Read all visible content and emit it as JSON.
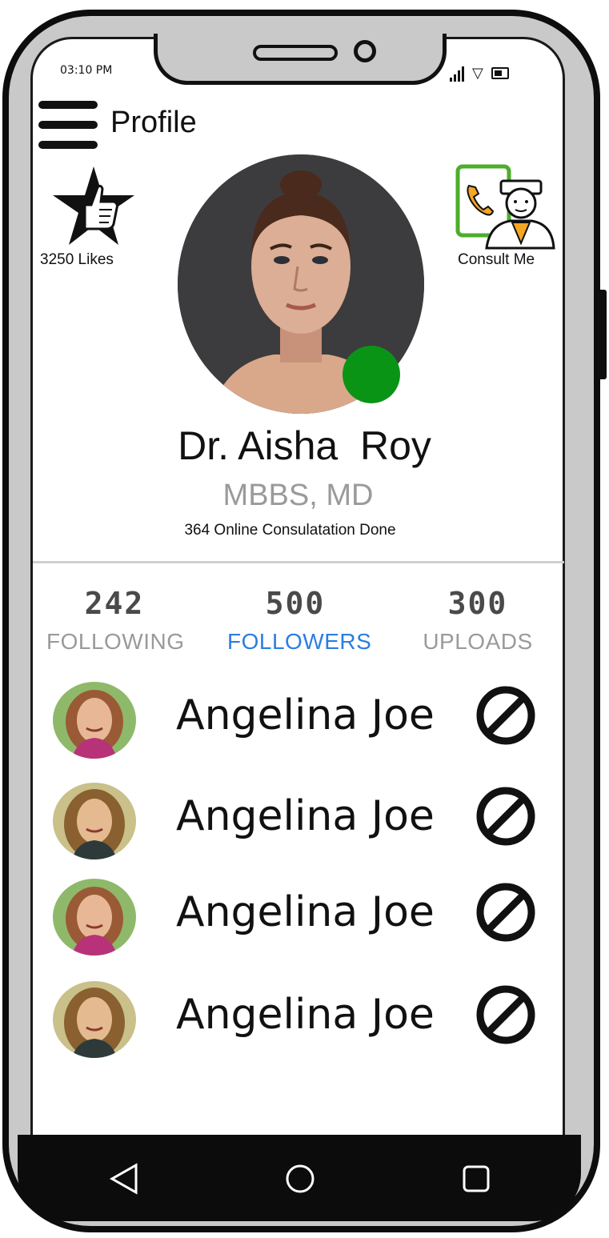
{
  "status_bar": {
    "time": "03:10 PM"
  },
  "header": {
    "title": "Profile"
  },
  "likes": {
    "label": "3250 Likes"
  },
  "consult": {
    "label": "Consult Me"
  },
  "profile": {
    "name": "Dr. Aisha  Roy",
    "degree": "MBBS, MD",
    "consultations": "364 Online Consulatation Done",
    "online_color": "#0a9416"
  },
  "stats": [
    {
      "value": "242",
      "label": "FOLLOWING"
    },
    {
      "value": "500",
      "label": "FOLLOWERS",
      "active": true
    },
    {
      "value": "300",
      "label": "UPLOADS"
    }
  ],
  "active_color": "#2b7de1",
  "followers": [
    {
      "name": "Angelina Joe",
      "action_icon": "block-icon"
    },
    {
      "name": "Angelina Joe",
      "action_icon": "block-icon"
    },
    {
      "name": "Angelina Joe",
      "action_icon": "block-icon"
    },
    {
      "name": "Angelina Joe",
      "action_icon": "block-icon"
    }
  ],
  "nav": {
    "back": "back-triangle-icon",
    "home": "home-circle-icon",
    "recents": "recents-square-icon"
  }
}
